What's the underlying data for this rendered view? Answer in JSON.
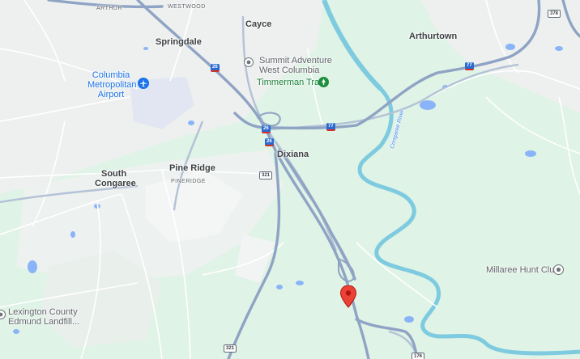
{
  "map": {
    "places": {
      "arthur": "ARTHUR",
      "westwood": "WESTWOOD",
      "cayce": "Cayce",
      "springdale": "Springdale",
      "arthurtown": "Arthurtown",
      "dixiana": "Dixiana",
      "pine_ridge": "Pine Ridge",
      "pineridge_small": "PINERIDGE",
      "south_congaree_1": "South",
      "south_congaree_2": "Congaree"
    },
    "pois": {
      "airport_1": "Columbia",
      "airport_2": "Metropolitan",
      "airport_3": "Airport",
      "summit_1": "Summit Adventure",
      "summit_2": "West Columbia",
      "timmerman": "Timmerman Trail",
      "millaree": "Millaree Hunt Club",
      "lexington_1": "Lexington County",
      "lexington_2": "Edmund Landfill..."
    },
    "river": "Congaree River",
    "shields": {
      "i26_a": "26",
      "i26_b": "26",
      "i26_c": "26",
      "i77_a": "77",
      "i77_b": "77",
      "us321_a": "321",
      "us321_b": "321",
      "us176": "176",
      "us378": "378"
    },
    "icons": {
      "airport": "airplane-icon",
      "summit": "place-dot-icon",
      "trail": "park-icon",
      "hunt_club": "place-dot-icon",
      "landfill": "place-dot-icon",
      "pin": "red-pin-icon"
    },
    "colors": {
      "land": "#dff3e6",
      "urban": "#f1f3f4",
      "water": "#8ab4f8",
      "river": "#7ecbe0",
      "highway": "#8fa3c4",
      "road": "#ffffff",
      "pin": "#ea4335"
    }
  }
}
